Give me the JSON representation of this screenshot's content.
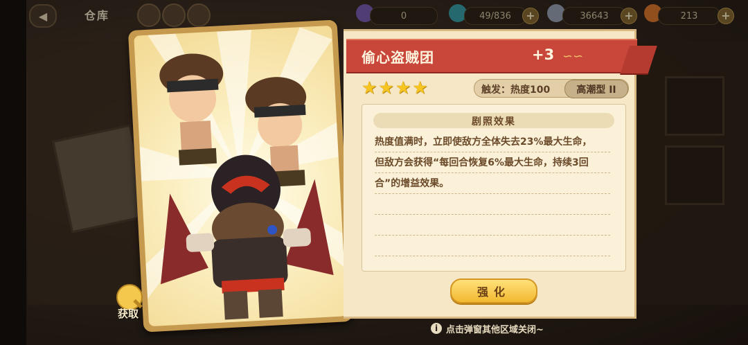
{
  "topbar": {
    "back_icon": "back-arrow-icon",
    "title": "仓库",
    "resources": [
      {
        "icon": "gem-icon",
        "value": "0",
        "color": "#7a5fb5"
      },
      {
        "icon": "bag-icon",
        "value": "49/836",
        "color": "#3aa0a8"
      },
      {
        "icon": "coin-icon",
        "value": "36643",
        "color": "#9aa3b5"
      },
      {
        "icon": "carrot-icon",
        "value": "213",
        "color": "#e07a2f"
      }
    ]
  },
  "card": {
    "name": "偷心盗贼团",
    "level": "+3",
    "stars": [
      "★",
      "★",
      "★",
      "★"
    ],
    "trigger_text": "触发：热度100",
    "trigger_type": "高潮型 II",
    "effect_title": "剧照效果",
    "effect_lines": [
      "热度值满时，立即使敌方全体失去23%最大生命，",
      "但敌方会获得“每回合恢复6%最大生命，持续3回",
      "合”的增益效果。",
      "",
      "",
      ""
    ],
    "enhance_label": "强化"
  },
  "obtain": {
    "label": "获取",
    "icon": "magnifier-icon"
  },
  "hint": {
    "text": "点击弹窗其他区域关闭~",
    "icon": "info-icon"
  },
  "colors": {
    "banner": "#c8463a",
    "panel": "#f6e7c6",
    "star": "#f6c521",
    "button": "#f2b930"
  }
}
